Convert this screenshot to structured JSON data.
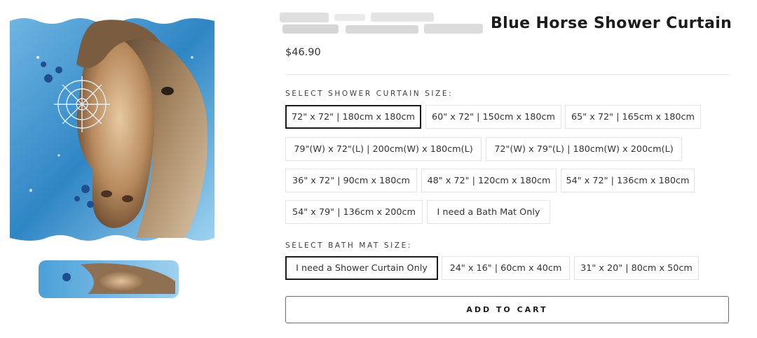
{
  "product": {
    "title": "Blue Horse Shower Curtain",
    "price": "$46.90"
  },
  "curtain_size": {
    "label": "SELECT SHOWER CURTAIN SIZE:",
    "selected": "72\" x 72\" | 180cm x 180cm",
    "options": [
      "72\" x 72\" | 180cm x 180cm",
      "60\" x 72\" | 150cm x 180cm",
      "65\" x 72\" | 165cm x 180cm",
      "79\"(W) x 72\"(L) | 200cm(W) x 180cm(L)",
      "72\"(W) x 79\"(L) | 180cm(W) x 200cm(L)",
      "36\" x 72\" | 90cm x 180cm",
      "48\" x 72\" | 120cm x 180cm",
      "54\" x 72\" | 136cm x 180cm",
      "54\" x 79\" | 136cm x 200cm",
      "I need a Bath Mat Only"
    ]
  },
  "bath_mat_size": {
    "label": "SELECT BATH MAT SIZE:",
    "selected": "I need a Shower Curtain Only",
    "options": [
      "I need a Shower Curtain Only",
      "24\" x 16\" | 60cm x 40cm",
      "31\" x 20\" | 80cm x 50cm"
    ]
  },
  "cart": {
    "add_label": "ADD TO CART"
  },
  "colors": {
    "selected_border": "#1a1a1a",
    "option_border": "#e3e3e3",
    "curtain_blue": "#3d8fc8"
  }
}
